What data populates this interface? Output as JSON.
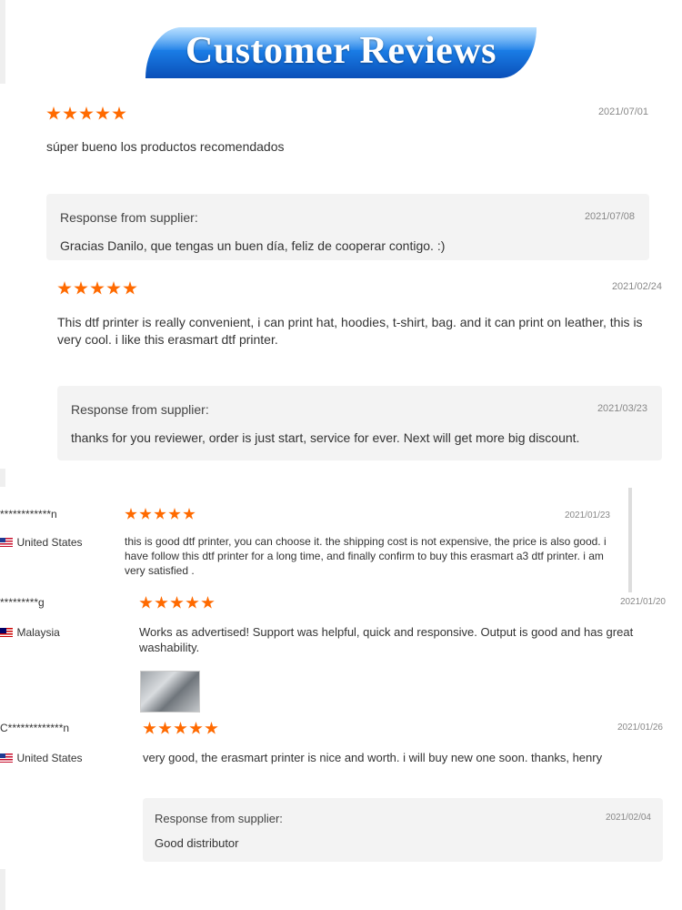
{
  "header": {
    "title": "Customer Reviews"
  },
  "colors": {
    "star": "#ff6a00",
    "banner": "#1a7de6"
  },
  "reviews": [
    {
      "date": "2021/07/01",
      "text": "súper bueno los productos recomendados",
      "reply": {
        "label": "Response from supplier:",
        "date": "2021/07/08",
        "text": "Gracias Danilo, que tengas un buen día, feliz de cooperar contigo. :)"
      }
    },
    {
      "date": "2021/02/24",
      "text": "This dtf printer is really convenient, i can print hat, hoodies, t-shirt, bag. and it can print on leather, this is very cool. i like this erasmart dtf printer.",
      "reply": {
        "label": "Response from supplier:",
        "date": "2021/03/23",
        "text": "thanks for you reviewer, order is just start, service for ever. Next will get more big discount."
      }
    },
    {
      "user": "************n",
      "country": "United States",
      "date": "2021/01/23",
      "text": "this is good dtf printer, you can choose it. the shipping cost is not expensive, the price is also good. i have follow this dtf printer for a long time, and finally confirm to buy this erasmart a3 dtf printer. i am very satisfied ."
    },
    {
      "user": "*********g",
      "country": "Malaysia",
      "date": "2021/01/20",
      "text": "Works as advertised! Support was helpful, quick and responsive. Output is good and has great washability."
    },
    {
      "user": "C*************n",
      "country": "United States",
      "date": "2021/01/26",
      "text": "very good, the erasmart printer is nice and worth. i will buy new one soon. thanks, henry",
      "reply": {
        "label": "Response from supplier:",
        "date": "2021/02/04",
        "text": "Good distributor"
      }
    }
  ]
}
